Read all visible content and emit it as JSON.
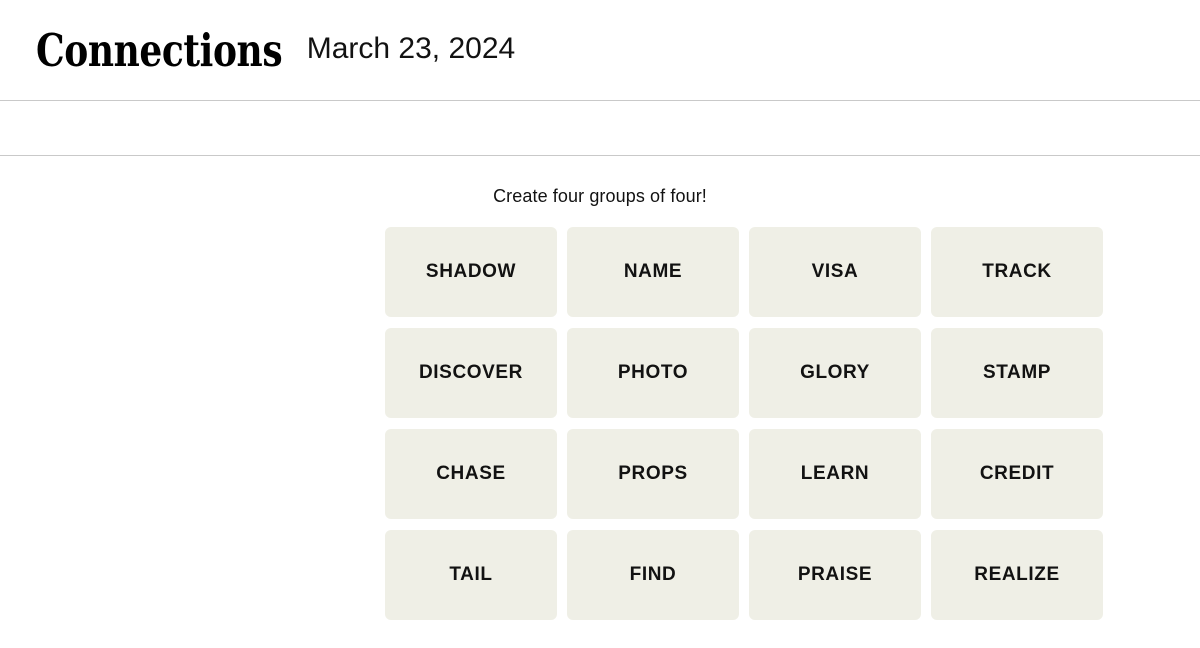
{
  "header": {
    "title": "Connections",
    "date": "March 23, 2024"
  },
  "toolbar": {
    "items": []
  },
  "main": {
    "instruction": "Create four groups of four!",
    "board": {
      "rows": 4,
      "columns": 4,
      "tiles": [
        "SHADOW",
        "NAME",
        "VISA",
        "TRACK",
        "DISCOVER",
        "PHOTO",
        "GLORY",
        "STAMP",
        "CHASE",
        "PROPS",
        "LEARN",
        "CREDIT",
        "TAIL",
        "FIND",
        "PRAISE",
        "REALIZE"
      ]
    }
  },
  "colors": {
    "page_background": "#ffffff",
    "tile_background": "#efefe6",
    "text": "#121212",
    "rule": "#c9c9c9"
  }
}
